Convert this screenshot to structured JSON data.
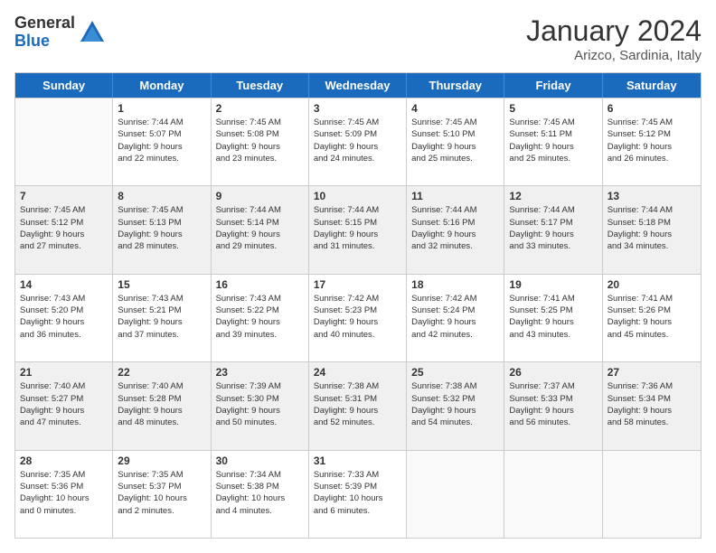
{
  "logo": {
    "general": "General",
    "blue": "Blue"
  },
  "title": "January 2024",
  "subtitle": "Arizco, Sardinia, Italy",
  "days": [
    "Sunday",
    "Monday",
    "Tuesday",
    "Wednesday",
    "Thursday",
    "Friday",
    "Saturday"
  ],
  "rows": [
    [
      {
        "num": "",
        "lines": []
      },
      {
        "num": "1",
        "lines": [
          "Sunrise: 7:44 AM",
          "Sunset: 5:07 PM",
          "Daylight: 9 hours",
          "and 22 minutes."
        ]
      },
      {
        "num": "2",
        "lines": [
          "Sunrise: 7:45 AM",
          "Sunset: 5:08 PM",
          "Daylight: 9 hours",
          "and 23 minutes."
        ]
      },
      {
        "num": "3",
        "lines": [
          "Sunrise: 7:45 AM",
          "Sunset: 5:09 PM",
          "Daylight: 9 hours",
          "and 24 minutes."
        ]
      },
      {
        "num": "4",
        "lines": [
          "Sunrise: 7:45 AM",
          "Sunset: 5:10 PM",
          "Daylight: 9 hours",
          "and 25 minutes."
        ]
      },
      {
        "num": "5",
        "lines": [
          "Sunrise: 7:45 AM",
          "Sunset: 5:11 PM",
          "Daylight: 9 hours",
          "and 25 minutes."
        ]
      },
      {
        "num": "6",
        "lines": [
          "Sunrise: 7:45 AM",
          "Sunset: 5:12 PM",
          "Daylight: 9 hours",
          "and 26 minutes."
        ]
      }
    ],
    [
      {
        "num": "7",
        "lines": [
          "Sunrise: 7:45 AM",
          "Sunset: 5:12 PM",
          "Daylight: 9 hours",
          "and 27 minutes."
        ]
      },
      {
        "num": "8",
        "lines": [
          "Sunrise: 7:45 AM",
          "Sunset: 5:13 PM",
          "Daylight: 9 hours",
          "and 28 minutes."
        ]
      },
      {
        "num": "9",
        "lines": [
          "Sunrise: 7:44 AM",
          "Sunset: 5:14 PM",
          "Daylight: 9 hours",
          "and 29 minutes."
        ]
      },
      {
        "num": "10",
        "lines": [
          "Sunrise: 7:44 AM",
          "Sunset: 5:15 PM",
          "Daylight: 9 hours",
          "and 31 minutes."
        ]
      },
      {
        "num": "11",
        "lines": [
          "Sunrise: 7:44 AM",
          "Sunset: 5:16 PM",
          "Daylight: 9 hours",
          "and 32 minutes."
        ]
      },
      {
        "num": "12",
        "lines": [
          "Sunrise: 7:44 AM",
          "Sunset: 5:17 PM",
          "Daylight: 9 hours",
          "and 33 minutes."
        ]
      },
      {
        "num": "13",
        "lines": [
          "Sunrise: 7:44 AM",
          "Sunset: 5:18 PM",
          "Daylight: 9 hours",
          "and 34 minutes."
        ]
      }
    ],
    [
      {
        "num": "14",
        "lines": [
          "Sunrise: 7:43 AM",
          "Sunset: 5:20 PM",
          "Daylight: 9 hours",
          "and 36 minutes."
        ]
      },
      {
        "num": "15",
        "lines": [
          "Sunrise: 7:43 AM",
          "Sunset: 5:21 PM",
          "Daylight: 9 hours",
          "and 37 minutes."
        ]
      },
      {
        "num": "16",
        "lines": [
          "Sunrise: 7:43 AM",
          "Sunset: 5:22 PM",
          "Daylight: 9 hours",
          "and 39 minutes."
        ]
      },
      {
        "num": "17",
        "lines": [
          "Sunrise: 7:42 AM",
          "Sunset: 5:23 PM",
          "Daylight: 9 hours",
          "and 40 minutes."
        ]
      },
      {
        "num": "18",
        "lines": [
          "Sunrise: 7:42 AM",
          "Sunset: 5:24 PM",
          "Daylight: 9 hours",
          "and 42 minutes."
        ]
      },
      {
        "num": "19",
        "lines": [
          "Sunrise: 7:41 AM",
          "Sunset: 5:25 PM",
          "Daylight: 9 hours",
          "and 43 minutes."
        ]
      },
      {
        "num": "20",
        "lines": [
          "Sunrise: 7:41 AM",
          "Sunset: 5:26 PM",
          "Daylight: 9 hours",
          "and 45 minutes."
        ]
      }
    ],
    [
      {
        "num": "21",
        "lines": [
          "Sunrise: 7:40 AM",
          "Sunset: 5:27 PM",
          "Daylight: 9 hours",
          "and 47 minutes."
        ]
      },
      {
        "num": "22",
        "lines": [
          "Sunrise: 7:40 AM",
          "Sunset: 5:28 PM",
          "Daylight: 9 hours",
          "and 48 minutes."
        ]
      },
      {
        "num": "23",
        "lines": [
          "Sunrise: 7:39 AM",
          "Sunset: 5:30 PM",
          "Daylight: 9 hours",
          "and 50 minutes."
        ]
      },
      {
        "num": "24",
        "lines": [
          "Sunrise: 7:38 AM",
          "Sunset: 5:31 PM",
          "Daylight: 9 hours",
          "and 52 minutes."
        ]
      },
      {
        "num": "25",
        "lines": [
          "Sunrise: 7:38 AM",
          "Sunset: 5:32 PM",
          "Daylight: 9 hours",
          "and 54 minutes."
        ]
      },
      {
        "num": "26",
        "lines": [
          "Sunrise: 7:37 AM",
          "Sunset: 5:33 PM",
          "Daylight: 9 hours",
          "and 56 minutes."
        ]
      },
      {
        "num": "27",
        "lines": [
          "Sunrise: 7:36 AM",
          "Sunset: 5:34 PM",
          "Daylight: 9 hours",
          "and 58 minutes."
        ]
      }
    ],
    [
      {
        "num": "28",
        "lines": [
          "Sunrise: 7:35 AM",
          "Sunset: 5:36 PM",
          "Daylight: 10 hours",
          "and 0 minutes."
        ]
      },
      {
        "num": "29",
        "lines": [
          "Sunrise: 7:35 AM",
          "Sunset: 5:37 PM",
          "Daylight: 10 hours",
          "and 2 minutes."
        ]
      },
      {
        "num": "30",
        "lines": [
          "Sunrise: 7:34 AM",
          "Sunset: 5:38 PM",
          "Daylight: 10 hours",
          "and 4 minutes."
        ]
      },
      {
        "num": "31",
        "lines": [
          "Sunrise: 7:33 AM",
          "Sunset: 5:39 PM",
          "Daylight: 10 hours",
          "and 6 minutes."
        ]
      },
      {
        "num": "",
        "lines": []
      },
      {
        "num": "",
        "lines": []
      },
      {
        "num": "",
        "lines": []
      }
    ]
  ]
}
